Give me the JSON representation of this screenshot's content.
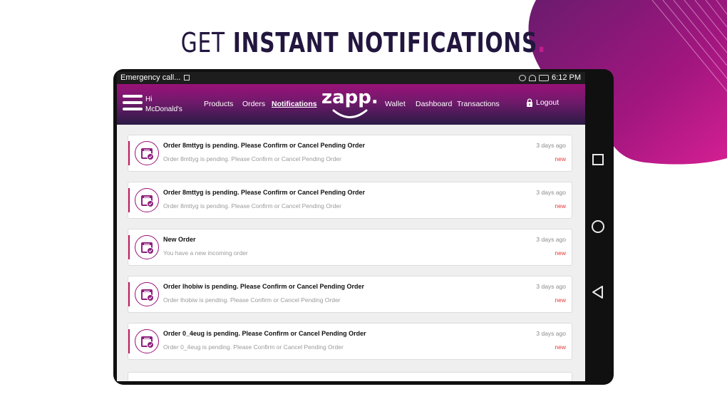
{
  "headline": {
    "light": "GET",
    "bold": "INSTANT NOTIFICATIONS",
    "dot": "."
  },
  "status_bar": {
    "left_text": "Emergency call...",
    "time": "6:12 PM"
  },
  "app_bar": {
    "greeting_line1": "Hi",
    "greeting_line2": "McDonald's",
    "nav": [
      {
        "label": "Products",
        "active": false
      },
      {
        "label": "Orders",
        "active": false
      },
      {
        "label": "Notifications",
        "active": true
      },
      {
        "label": "Wallet",
        "active": false
      },
      {
        "label": "Dashboard",
        "active": false
      },
      {
        "label": "Transactions",
        "active": false
      }
    ],
    "logo": "zapp.",
    "logout": "Logout"
  },
  "notifications": [
    {
      "title": "Order 8mttyg is pending. Please Confirm or Cancel Pending Order",
      "body": "Order 8mttyg is pending. Please Confirm or Cancel Pending Order",
      "time": "3 days ago",
      "badge": "new"
    },
    {
      "title": "Order 8mttyg is pending. Please Confirm or Cancel Pending Order",
      "body": "Order 8mttyg is pending. Please Confirm or Cancel Pending Order",
      "time": "3 days ago",
      "badge": "new"
    },
    {
      "title": "New Order",
      "body": "You have a new incoming order",
      "time": "3 days ago",
      "badge": "new"
    },
    {
      "title": "Order lhobiw is pending. Please Confirm or Cancel Pending Order",
      "body": "Order lhobiw is pending. Please Confirm or Cancel Pending Order",
      "time": "3 days ago",
      "badge": "new"
    },
    {
      "title": "Order 0_4eug is pending. Please Confirm or Cancel Pending Order",
      "body": "Order 0_4eug is pending. Please Confirm or Cancel Pending Order",
      "time": "3 days ago",
      "badge": "new"
    }
  ],
  "colors": {
    "brand_magenta": "#c11e8f",
    "brand_dark": "#22163f",
    "new_badge": "#e53935"
  },
  "icons": {
    "menu": "hamburger-icon",
    "logout": "lock-icon",
    "notification": "order-box-icon"
  }
}
